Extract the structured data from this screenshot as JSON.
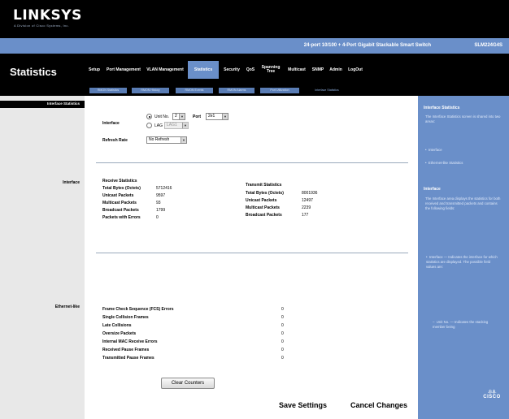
{
  "header": {
    "logo": "LINKSYS",
    "logo_sub": "A Division of Cisco Systems, Inc.",
    "model_description": "24-port 10/100 + 4-Port Gigabit Stackable Smart Switch",
    "model_number": "SLM224G4S"
  },
  "page_title": "Statistics",
  "nav": {
    "tabs": [
      {
        "label": "Setup"
      },
      {
        "label": "Port Management"
      },
      {
        "label": "VLAN Management"
      },
      {
        "label": "Statistics",
        "active": true
      },
      {
        "label": "Security"
      },
      {
        "label": "QoS"
      },
      {
        "label": "Spanning Tree"
      },
      {
        "label": "Multicast"
      },
      {
        "label": "SNMP"
      },
      {
        "label": "Admin"
      },
      {
        "label": "LogOut"
      }
    ],
    "subtabs": [
      {
        "label": "RMON Statistics"
      },
      {
        "label": "RMON History"
      },
      {
        "label": "RMON Events"
      },
      {
        "label": "RMON Alarms"
      },
      {
        "label": "Port Utilization"
      },
      {
        "label": "Interface Statistics",
        "active": true
      }
    ]
  },
  "left": {
    "header": "Interface Statistics",
    "section_interface": "Interface",
    "section_ethernet": "Ethernet-like"
  },
  "form": {
    "interface_label": "Interface",
    "unit_no_label": "Unit No.",
    "unit_no_value": "2",
    "port_label": "Port",
    "port_value": "2e1",
    "lag_label": "LAG",
    "lag_value": "LAG1",
    "refresh_label": "Refresh Rate",
    "refresh_value": "No Refresh"
  },
  "receive": {
    "title": "Receive Statistics",
    "rows": [
      {
        "label": "Total Bytes (Octets)",
        "value": "5712416"
      },
      {
        "label": "Unicast Packets",
        "value": "9597"
      },
      {
        "label": "Multicast Packets",
        "value": "93"
      },
      {
        "label": "Broadcast Packets",
        "value": "1799"
      },
      {
        "label": "Packets with Errors",
        "value": "0"
      }
    ]
  },
  "transmit": {
    "title": "Transmit Statistics",
    "rows": [
      {
        "label": "Total Bytes (Octets)",
        "value": "8001936"
      },
      {
        "label": "Unicast Packets",
        "value": "12497"
      },
      {
        "label": "Multicast Packets",
        "value": "2239"
      },
      {
        "label": "Broadcast Packets",
        "value": "177"
      }
    ]
  },
  "ethernet": {
    "rows": [
      {
        "label": "Frame Check Sequence (FCS) Errors",
        "value": "0"
      },
      {
        "label": "Single Collision Frames",
        "value": "0"
      },
      {
        "label": "Late Collisions",
        "value": "0"
      },
      {
        "label": "Oversize Packets",
        "value": "0"
      },
      {
        "label": "Internal MAC Receive Errors",
        "value": "0"
      },
      {
        "label": "Received Pause Frames",
        "value": "0"
      },
      {
        "label": "Transmitted Pause Frames",
        "value": "0"
      }
    ]
  },
  "buttons": {
    "clear_counters": "Clear Counters",
    "save_settings": "Save Settings",
    "cancel_changes": "Cancel Changes"
  },
  "help": {
    "title": "Interface Statistics",
    "intro": "The Interface Statistics screen is shared into two areas:",
    "bullets": [
      "Interface",
      "Ethernet-like Statistics"
    ],
    "section_title": "Interface",
    "section_text": "The Interface area displays the statistics for both received and transmitted packets and contains the following fields:",
    "field_bullet": "Interface — Indicates the interface for which statistics are displayed. The possible field values are:",
    "sub_bullet": "Unit No. — Indicates the stacking member being",
    "cisco_word": "CISCO"
  }
}
